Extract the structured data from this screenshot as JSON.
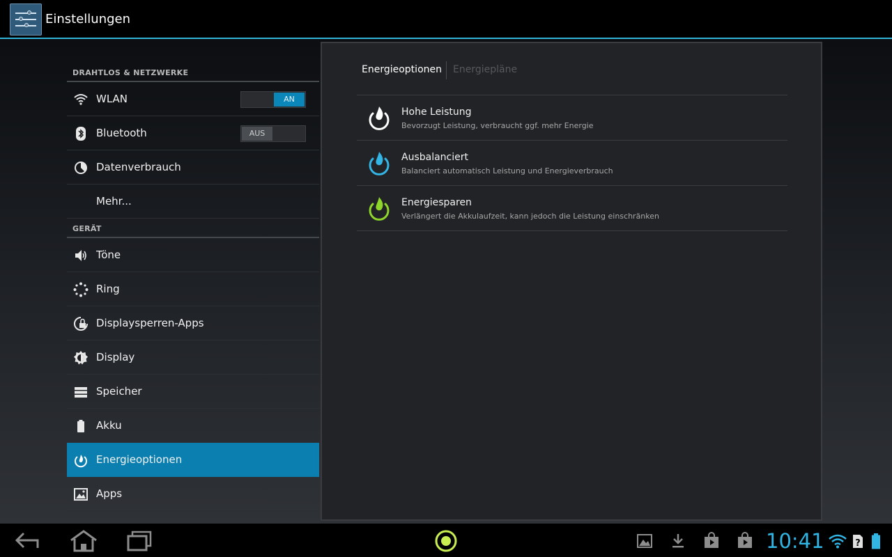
{
  "app": {
    "title": "Einstellungen"
  },
  "sidebar": {
    "sections": [
      {
        "header": "DRAHTLOS & NETZWERKE",
        "items": [
          {
            "label": "WLAN",
            "icon": "wifi-icon",
            "toggle": "AN"
          },
          {
            "label": "Bluetooth",
            "icon": "bluetooth-icon",
            "toggle": "AUS"
          },
          {
            "label": "Datenverbrauch",
            "icon": "data-usage-icon"
          },
          {
            "label": "Mehr...",
            "icon": ""
          }
        ]
      },
      {
        "header": "GERÄT",
        "items": [
          {
            "label": "Töne",
            "icon": "speaker-icon"
          },
          {
            "label": "Ring",
            "icon": "ring-icon"
          },
          {
            "label": "Displaysperren-Apps",
            "icon": "lock-icon"
          },
          {
            "label": "Display",
            "icon": "brightness-icon"
          },
          {
            "label": "Speicher",
            "icon": "storage-icon"
          },
          {
            "label": "Akku",
            "icon": "battery-icon"
          },
          {
            "label": "Energieoptionen",
            "icon": "power-flame-icon",
            "active": true
          },
          {
            "label": "Apps",
            "icon": "apps-icon"
          }
        ]
      }
    ]
  },
  "detail": {
    "tabs": [
      {
        "label": "Energieoptionen",
        "selected": true
      },
      {
        "label": "Energiepläne",
        "selected": false
      }
    ],
    "plans": [
      {
        "title": "Hohe Leistung",
        "description": "Bevorzugt Leistung, verbraucht ggf. mehr Energie",
        "color": "#ffffff"
      },
      {
        "title": "Ausbalanciert",
        "description": "Balanciert automatisch Leistung und Energieverbrauch",
        "color": "#33b5e5"
      },
      {
        "title": "Energiesparen",
        "description": "Verlängert die Akkulaufzeit, kann jedoch die Leistung einschränken",
        "color": "#8ed62a"
      }
    ]
  },
  "statusbar": {
    "time": "10:41"
  },
  "colors": {
    "accent": "#33b5e5",
    "active_bg": "#0a7fb0"
  }
}
